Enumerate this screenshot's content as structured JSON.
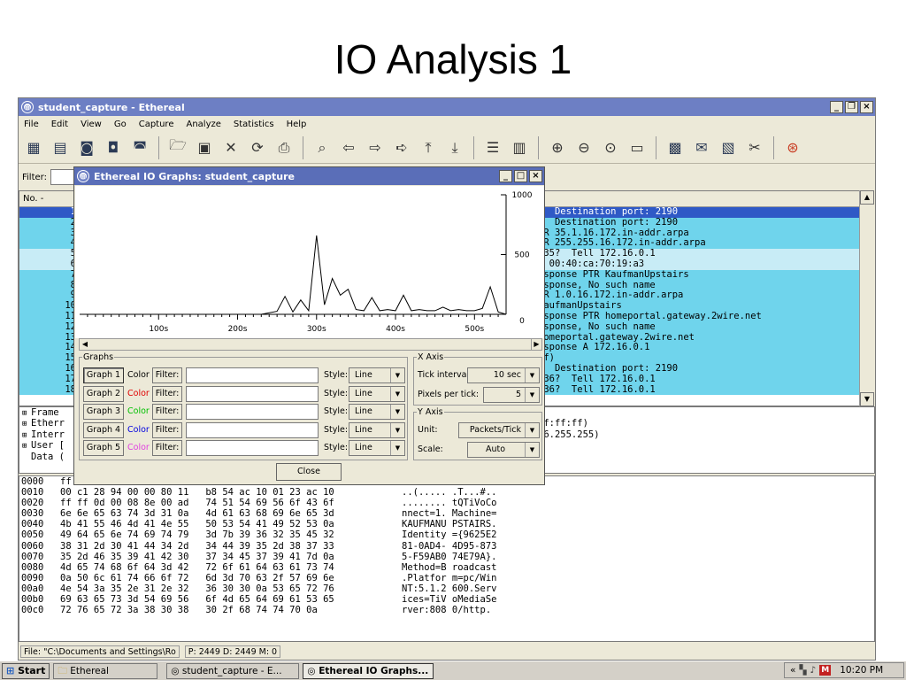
{
  "slide_title": "IO Analysis 1",
  "main_window": {
    "title": "student_capture - Ethereal",
    "menu": [
      "File",
      "Edit",
      "View",
      "Go",
      "Capture",
      "Analyze",
      "Statistics",
      "Help"
    ],
    "filter_label": "Filter:",
    "list_header": "No. -",
    "packets": [
      {
        "no": "1",
        "info": "5  Destination port: 2190"
      },
      {
        "no": "2",
        "info": "0  Destination port: 2190"
      },
      {
        "no": "3",
        "info": "TR 35.1.16.172.in-addr.arpa"
      },
      {
        "no": "4",
        "info": "TR 255.255.16.172.in-addr.arpa"
      },
      {
        "no": "5",
        "info": ".35?  Tell 172.16.0.1"
      },
      {
        "no": "6",
        "info": "t 00:40:ca:70:19:a3"
      },
      {
        "no": "7",
        "info": "esponse PTR KaufmanUpstairs"
      },
      {
        "no": "8",
        "info": "esponse, No such name"
      },
      {
        "no": "9",
        "info": "TR 1.0.16.172.in-addr.arpa"
      },
      {
        "no": "10",
        "info": "KaufmanUpstairs"
      },
      {
        "no": "11",
        "info": "esponse PTR homeportal.gateway.2wire.net"
      },
      {
        "no": "12",
        "info": "esponse, No such name"
      },
      {
        "no": "13",
        "info": "homeportal.gateway.2wire.net"
      },
      {
        "no": "14",
        "info": "esponse A 172.16.0.1"
      },
      {
        "no": "15",
        "info": "6f)"
      },
      {
        "no": "16",
        "info": "7  Destination port: 2190"
      },
      {
        "no": "17",
        "info": ".36?  Tell 172.16.0.1"
      },
      {
        "no": "18",
        "info": ".36?  Tell 172.16.0.1"
      }
    ],
    "tree": [
      {
        "label": "Frame",
        "right": ""
      },
      {
        "label": "Etherr",
        "right": "ff:ff:ff)"
      },
      {
        "label": "Interr",
        "right": "16.255.255)"
      },
      {
        "label": "User [",
        "right": ""
      },
      {
        "label": "Data (",
        "right": ""
      }
    ],
    "hex_rows": [
      {
        "off": "0000",
        "hex": "ff",
        "ascii": ""
      },
      {
        "off": "0010",
        "hex": "00 c1 28 94 00 00 80 11   b8 54 ac 10 01 23 ac 10",
        "ascii": "..(..... .T...#.."
      },
      {
        "off": "0020",
        "hex": "ff ff 0d 00 08 8e 00 ad   74 51 54 69 56 6f 43 6f",
        "ascii": "........ tQTiVoCo"
      },
      {
        "off": "0030",
        "hex": "6e 6e 65 63 74 3d 31 0a   4d 61 63 68 69 6e 65 3d",
        "ascii": "nnect=1. Machine="
      },
      {
        "off": "0040",
        "hex": "4b 41 55 46 4d 41 4e 55   50 53 54 41 49 52 53 0a",
        "ascii": "KAUFMANU PSTAIRS."
      },
      {
        "off": "0050",
        "hex": "49 64 65 6e 74 69 74 79   3d 7b 39 36 32 35 45 32",
        "ascii": "Identity ={9625E2"
      },
      {
        "off": "0060",
        "hex": "38 31 2d 30 41 44 34 2d   34 44 39 35 2d 38 37 33",
        "ascii": "81-0AD4- 4D95-873"
      },
      {
        "off": "0070",
        "hex": "35 2d 46 35 39 41 42 30   37 34 45 37 39 41 7d 0a",
        "ascii": "5-F59AB0 74E79A}."
      },
      {
        "off": "0080",
        "hex": "4d 65 74 68 6f 64 3d 42   72 6f 61 64 63 61 73 74",
        "ascii": "Method=B roadcast"
      },
      {
        "off": "0090",
        "hex": "0a 50 6c 61 74 66 6f 72   6d 3d 70 63 2f 57 69 6e",
        "ascii": ".Platfor m=pc/Win"
      },
      {
        "off": "00a0",
        "hex": "4e 54 3a 35 2e 31 2e 32   36 30 30 0a 53 65 72 76",
        "ascii": "NT:5.1.2 600.Serv"
      },
      {
        "off": "00b0",
        "hex": "69 63 65 73 3d 54 69 56   6f 4d 65 64 69 61 53 65",
        "ascii": "ices=TiV oMediaSe"
      },
      {
        "off": "00c0",
        "hex": "72 76 65 72 3a 38 30 38   30 2f 68 74 74 70 0a",
        "ascii": "rver:808 0/http."
      }
    ],
    "status_file": "File: \"C:\\Documents and Settings\\Ro",
    "status_counts": "P: 2449 D: 2449 M: 0",
    "colors": {
      "title_bar": "#6d7fc4",
      "selected_row": "#2f59c6",
      "row_cyan": "#6fd4ec",
      "row_light": "#c8ecf6"
    }
  },
  "io_dialog": {
    "title": "Ethereal IO Graphs: student_capture",
    "graphs_legend": "Graphs",
    "color_label": "Color",
    "filter_btn": "Filter:",
    "style_label": "Style:",
    "graphs": [
      {
        "label": "Graph 1",
        "style": "Line",
        "color": "#000000",
        "pressed": true
      },
      {
        "label": "Graph 2",
        "style": "Line",
        "color": "#e00000",
        "pressed": false
      },
      {
        "label": "Graph 3",
        "style": "Line",
        "color": "#00c000",
        "pressed": false
      },
      {
        "label": "Graph 4",
        "style": "Line",
        "color": "#0000e0",
        "pressed": false
      },
      {
        "label": "Graph 5",
        "style": "Line",
        "color": "#e040e0",
        "pressed": false
      }
    ],
    "xaxis": {
      "legend": "X Axis",
      "tick_interval_label": "Tick interval:",
      "tick_interval": "10 sec",
      "pixels_label": "Pixels per tick:",
      "pixels": "5"
    },
    "yaxis": {
      "legend": "Y Axis",
      "unit_label": "Unit:",
      "unit": "Packets/Tick",
      "scale_label": "Scale:",
      "scale": "Auto"
    },
    "close_label": "Close"
  },
  "chart_data": {
    "type": "line",
    "xlabel": "",
    "ylabel": "",
    "x_ticks": [
      "100s",
      "200s",
      "300s",
      "400s",
      "500s"
    ],
    "y_ticks": [
      "0",
      "500",
      "1000"
    ],
    "xlim": [
      0,
      540
    ],
    "ylim": [
      0,
      1000
    ],
    "series": [
      {
        "color": "#000000",
        "x": [
          0,
          200,
          230,
          250,
          260,
          270,
          280,
          290,
          300,
          310,
          320,
          330,
          340,
          350,
          360,
          370,
          380,
          390,
          400,
          410,
          420,
          430,
          440,
          450,
          460,
          470,
          480,
          490,
          500,
          510,
          520,
          530,
          540
        ],
        "y": [
          0,
          0,
          0,
          25,
          150,
          20,
          120,
          30,
          660,
          80,
          300,
          160,
          210,
          40,
          30,
          140,
          30,
          40,
          30,
          160,
          30,
          40,
          30,
          30,
          60,
          30,
          40,
          30,
          30,
          50,
          230,
          20,
          0
        ]
      }
    ]
  },
  "taskbar": {
    "start": "Start",
    "items": [
      {
        "label": "Ethereal",
        "active": false
      },
      {
        "label": "student_capture - E...",
        "active": false
      },
      {
        "label": "Ethereal IO Graphs...",
        "active": true
      }
    ],
    "tray_badge": "M",
    "clock": "10:20 PM"
  }
}
